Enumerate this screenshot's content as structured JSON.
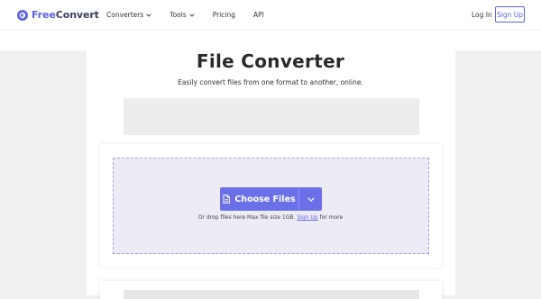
{
  "header": {
    "logo": {
      "free": "Free",
      "convert": "Convert",
      "icon": "freeconvert-logo-icon"
    },
    "nav": [
      {
        "label": "Converters",
        "has_dropdown": true
      },
      {
        "label": "Tools",
        "has_dropdown": true
      },
      {
        "label": "Pricing",
        "has_dropdown": false
      },
      {
        "label": "API",
        "has_dropdown": false
      }
    ],
    "login_label": "Log In",
    "signup_label": "Sign Up"
  },
  "main": {
    "title": "File Converter",
    "subtitle": "Easily convert files from one format to another, online.",
    "upload": {
      "choose_label": "Choose Files",
      "hint_prefix": "Or drop files here Max file size 1GB.",
      "hint_link": "Sign Up",
      "hint_suffix": "for more",
      "icons": [
        "file-icon",
        "chevron-down-icon"
      ]
    }
  },
  "colors": {
    "brand": "#5e64e2",
    "button": "#6b70e8",
    "dropzone": "#edecf6",
    "page_bg": "#f0f0f1"
  }
}
